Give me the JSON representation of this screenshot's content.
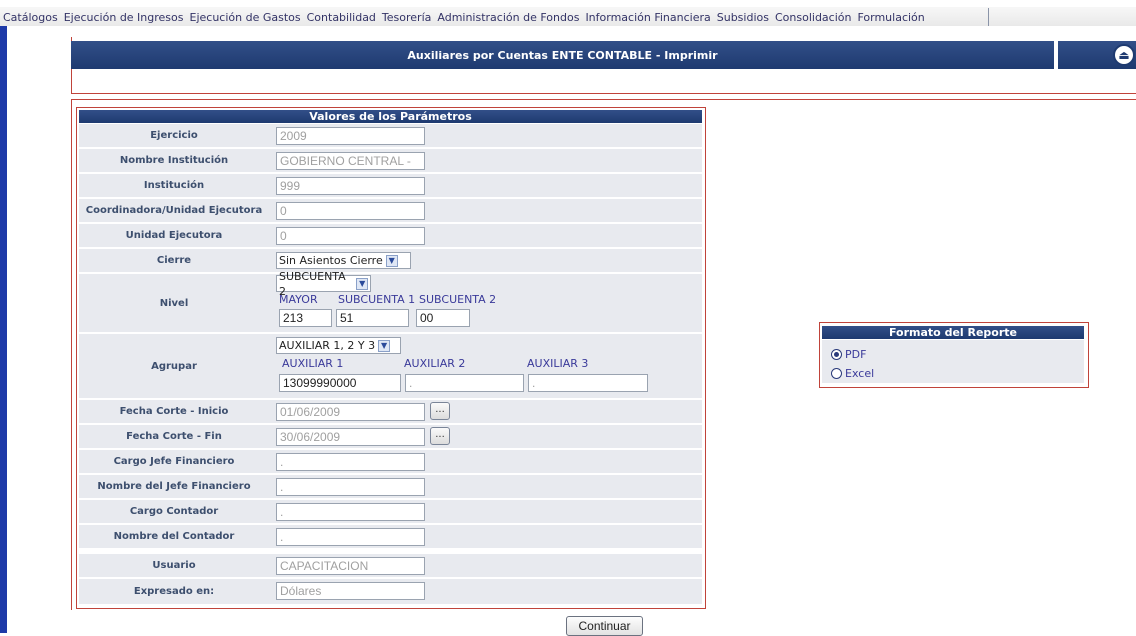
{
  "menu": {
    "items": [
      "Catálogos",
      "Ejecución de Ingresos",
      "Ejecución de Gastos",
      "Contabilidad",
      "Tesorería",
      "Administración de Fondos",
      "Información Financiera",
      "Subsidios",
      "Consolidación",
      "Formulación"
    ]
  },
  "title": "Auxiliares por Cuentas ENTE CONTABLE - Imprimir",
  "params": {
    "header": "Valores de los Parámetros",
    "ejercicio": {
      "label": "Ejercicio",
      "value": "2009"
    },
    "nombre_institucion": {
      "label": "Nombre Institución",
      "value": "GOBIERNO CENTRAL - "
    },
    "institucion": {
      "label": "Institución",
      "value": "999"
    },
    "coordinadora": {
      "label": "Coordinadora/Unidad Ejecutora",
      "value": "0"
    },
    "unidad_ejecutora": {
      "label": "Unidad Ejecutora",
      "value": "0"
    },
    "cierre": {
      "label": "Cierre",
      "selected": "Sin Asientos Cierre"
    },
    "nivel": {
      "label": "Nivel",
      "selected": "SUBCUENTA 2",
      "sublabels": [
        "MAYOR",
        "SUBCUENTA 1",
        "SUBCUENTA 2"
      ],
      "values": [
        "213",
        "51",
        "00"
      ]
    },
    "agrupar": {
      "label": "Agrupar",
      "selected": "AUXILIAR 1, 2 Y 3",
      "sublabels": [
        "AUXILIAR 1",
        "AUXILIAR 2",
        "AUXILIAR 3"
      ],
      "values": [
        "13099990000",
        ".",
        "."
      ]
    },
    "fecha_inicio": {
      "label": "Fecha Corte - Inicio",
      "value": "01/06/2009",
      "button": "..."
    },
    "fecha_fin": {
      "label": "Fecha Corte - Fin",
      "value": "30/06/2009",
      "button": "..."
    },
    "cargo_jefe": {
      "label": "Cargo Jefe Financiero",
      "value": "."
    },
    "nombre_jefe": {
      "label": "Nombre del Jefe Financiero",
      "value": "."
    },
    "cargo_contador": {
      "label": "Cargo Contador",
      "value": "."
    },
    "nombre_contador": {
      "label": "Nombre del Contador",
      "value": "."
    },
    "usuario": {
      "label": "Usuario",
      "value": "CAPACITACION"
    },
    "expresado": {
      "label": "Expresado en:",
      "value": "Dólares"
    }
  },
  "formato": {
    "header": "Formato del Reporte",
    "options": [
      "PDF",
      "Excel"
    ],
    "selected": "PDF"
  },
  "continue_label": "Continuar",
  "colors": {
    "header_blue": "#1e3a70",
    "frame_red": "#c0433a",
    "row_gray": "#e8eaef"
  }
}
